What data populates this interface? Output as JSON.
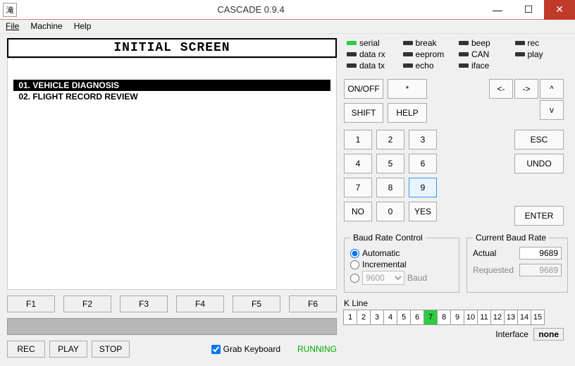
{
  "window": {
    "icon": "滝",
    "title": "CASCADE 0.9.4",
    "min": "—",
    "max": "☐",
    "close": "✕"
  },
  "menu": {
    "file": "File",
    "machine": "Machine",
    "help": "Help"
  },
  "screen": {
    "title": "INITIAL SCREEN",
    "rows": [
      {
        "text": "01. VEHICLE DIAGNOSIS",
        "selected": true
      },
      {
        "text": "02. FLIGHT RECORD REVIEW",
        "selected": false
      }
    ]
  },
  "fkeys": [
    "F1",
    "F2",
    "F3",
    "F4",
    "F5",
    "F6"
  ],
  "controls": {
    "rec": "REC",
    "play": "PLAY",
    "stop": "STOP",
    "grab": "Grab Keyboard",
    "grab_checked": true,
    "status": "RUNNING"
  },
  "indicators": [
    {
      "name": "serial",
      "on": true
    },
    {
      "name": "break",
      "on": false
    },
    {
      "name": "beep",
      "on": false
    },
    {
      "name": "rec",
      "on": false
    },
    {
      "name": "data rx",
      "on": false
    },
    {
      "name": "eeprom",
      "on": false
    },
    {
      "name": "CAN",
      "on": false
    },
    {
      "name": "play",
      "on": false
    },
    {
      "name": "data tx",
      "on": false
    },
    {
      "name": "echo",
      "on": false
    },
    {
      "name": "iface",
      "on": false
    }
  ],
  "pad": {
    "onoff": "ON/OFF",
    "star": "*",
    "shift": "SHIFT",
    "help": "HELP",
    "left": "<-",
    "up": "^",
    "down": "v",
    "right": "->",
    "esc": "ESC",
    "undo": "UNDO",
    "enter": "ENTER",
    "no": "NO",
    "yes": "YES",
    "nums": [
      "1",
      "2",
      "3",
      "4",
      "5",
      "6",
      "7",
      "8",
      "9"
    ],
    "zero": "0",
    "selected": "9"
  },
  "baud": {
    "legend": "Baud Rate Control",
    "auto": "Automatic",
    "inc": "Incremental",
    "manual_value": "9600",
    "unit": "Baud",
    "mode": "auto"
  },
  "current": {
    "legend": "Current Baud Rate",
    "actual_label": "Actual",
    "actual": "9689",
    "req_label": "Requested",
    "req": "9689"
  },
  "kline": {
    "label": "K Line",
    "cells": [
      1,
      2,
      3,
      4,
      5,
      6,
      7,
      8,
      9,
      10,
      11,
      12,
      13,
      14,
      15
    ],
    "active": 7
  },
  "iface": {
    "label": "Interface",
    "value": "none"
  }
}
